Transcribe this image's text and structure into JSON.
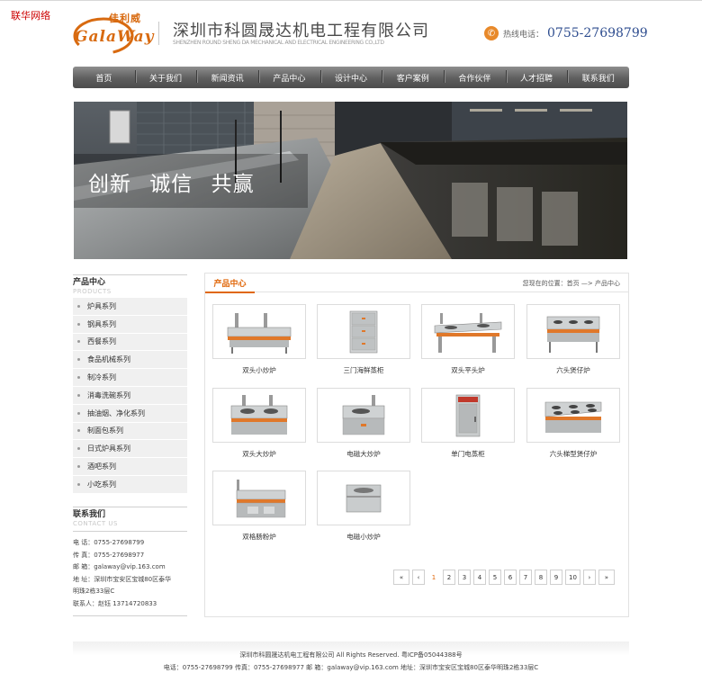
{
  "watermark": "联华网络",
  "logo": {
    "cn": "佳利威",
    "word": "GalaWay"
  },
  "company": {
    "name_cn": "深圳市科圆晟达机电工程有限公司",
    "name_en": "SHENZHEN ROUND SHENG DA MECHANICAL AND ELECTRICAL ENGINEERING CO.,LTD"
  },
  "hotline": {
    "label": "热线电话：",
    "number": "0755-27698799"
  },
  "nav": [
    "首页",
    "关于我们",
    "新闻资讯",
    "产品中心",
    "设计中心",
    "客户案例",
    "合作伙伴",
    "人才招聘",
    "联系我们"
  ],
  "banner": {
    "slogan": "创新  诚信  共赢"
  },
  "sidebar": {
    "products_title": "产品中心",
    "products_sub": "PRODUCTS",
    "items": [
      "炉具系列",
      "钢具系列",
      "西餐系列",
      "食品机械系列",
      "制冷系列",
      "消毒洗碗系列",
      "抽油烟、净化系列",
      "制面包系列",
      "日式炉具系列",
      "酒吧系列",
      "小吃系列"
    ],
    "contact_title": "联系我们",
    "contact_sub": "CONTACT US",
    "contact_lines": [
      "电 话：0755-27698799",
      "传 真：0755-27698977",
      "邮 箱：galaway@vip.163.com",
      "地 址：深圳市宝安区宝城80区泰华",
      "明珠2栋33层C",
      "联系人：赵钰 13714720833"
    ]
  },
  "content": {
    "title": "产品中心",
    "breadcrumb": {
      "prefix": "您现在的位置：",
      "home": "首页",
      "arrow": "—>",
      "current": "产品中心"
    }
  },
  "products": [
    {
      "name": "双头小炒炉",
      "icon": "double-wok-stove-icon"
    },
    {
      "name": "三门海鲜蒸柜",
      "icon": "three-door-steamer-icon"
    },
    {
      "name": "双头平头炉",
      "icon": "double-flat-stove-icon"
    },
    {
      "name": "六头煲仔炉",
      "icon": "six-burner-clay-pot-stove-icon"
    },
    {
      "name": "双头大炒炉",
      "icon": "double-big-wok-stove-icon"
    },
    {
      "name": "电磁大炒炉",
      "icon": "induction-big-wok-icon"
    },
    {
      "name": "单门电蒸柜",
      "icon": "single-door-steamer-icon"
    },
    {
      "name": "六头梯型煲仔炉",
      "icon": "six-burner-step-stove-icon"
    },
    {
      "name": "双格肠粉炉",
      "icon": "rice-roll-steamer-icon"
    },
    {
      "name": "电磁小炒炉",
      "icon": "induction-small-wok-icon"
    }
  ],
  "pagination": {
    "first": "«",
    "prev": "‹",
    "pages": [
      "1",
      "2",
      "3",
      "4",
      "5",
      "6",
      "7",
      "8",
      "9",
      "10"
    ],
    "current": "1",
    "next": "›",
    "last": "»"
  },
  "footer": {
    "line1": "深圳市科圆晟达机电工程有限公司 All Rights Reserved. 粤ICP备05044388号",
    "line2": "电话：0755-27698799 传真：0755-27698977 邮 箱：galaway@vip.163.com 地址：深圳市宝安区宝城80区泰华明珠2栋33层C"
  },
  "colors": {
    "accent": "#e0670a",
    "nav_dark": "#4c4c4c",
    "hotline": "#2e4d8f",
    "logo": "#d86a10"
  }
}
